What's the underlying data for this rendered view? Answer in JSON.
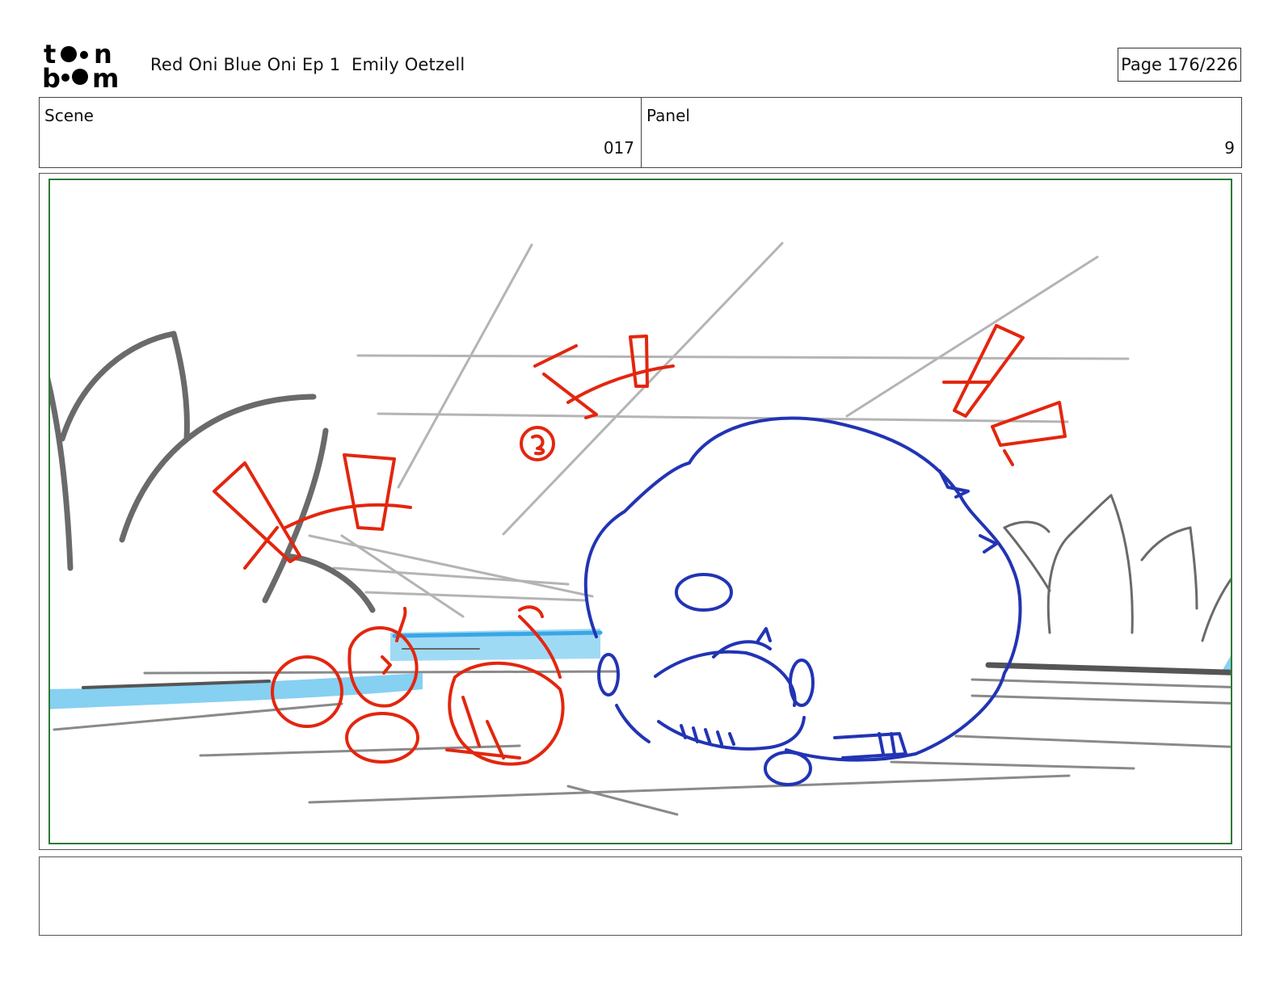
{
  "header": {
    "logo_text": "toon boom",
    "title": "Red Oni Blue Oni Ep 1  Emily Oetzell",
    "page_label": "Page 176/226"
  },
  "info": {
    "scene_label": "Scene",
    "scene_value": "017",
    "panel_label": "Panel",
    "panel_value": "9"
  },
  "drawing": {
    "colors": {
      "red": "#e3260e",
      "blue": "#2234b4",
      "grey": "#6e6e6e",
      "light_grey": "#b4b4b4",
      "water": "#86d0f2",
      "frame_border": "#2f7a35"
    }
  },
  "notes": {
    "text": ""
  }
}
